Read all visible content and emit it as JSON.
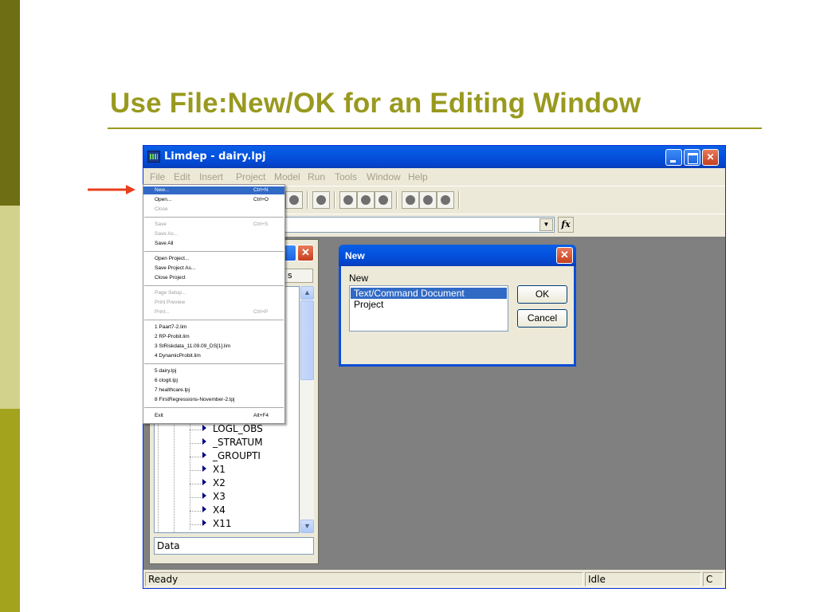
{
  "slide": {
    "title": "Use File:New/OK for an Editing Window",
    "colors": {
      "accent": "#99991f",
      "bar_dark": "#6e6e14",
      "bar_light": "#d2d28c",
      "bar_mid": "#a3a31e",
      "arrow": "#e8401c"
    }
  },
  "app": {
    "title": "Limdep - dairy.lpj",
    "menubar": [
      "File",
      "Edit",
      "Insert",
      "Project",
      "Model",
      "Run",
      "Tools",
      "Window",
      "Help"
    ],
    "fx_label": "fx",
    "status_left": "Ready",
    "status_mid": "Idle",
    "status_right": "C"
  },
  "file_menu": {
    "items": [
      {
        "label": "New...",
        "shortcut": "Ctrl+N",
        "state": "highlighted"
      },
      {
        "label": "Open...",
        "shortcut": "Ctrl+O",
        "state": "enabled"
      },
      {
        "label": "Close",
        "shortcut": "",
        "state": "disabled"
      },
      {
        "label": "Save",
        "shortcut": "Ctrl+S",
        "state": "disabled"
      },
      {
        "label": "Save As...",
        "shortcut": "",
        "state": "disabled"
      },
      {
        "label": "Save All",
        "shortcut": "",
        "state": "enabled"
      },
      {
        "label": "Open Project...",
        "shortcut": "",
        "state": "enabled"
      },
      {
        "label": "Save Project As...",
        "shortcut": "",
        "state": "enabled"
      },
      {
        "label": "Close Project",
        "shortcut": "",
        "state": "enabled"
      },
      {
        "label": "Page Setup...",
        "shortcut": "",
        "state": "disabled"
      },
      {
        "label": "Print Preview",
        "shortcut": "",
        "state": "disabled"
      },
      {
        "label": "Print...",
        "shortcut": "Ctrl+P",
        "state": "disabled"
      },
      {
        "label": "1 Paart7-2.lim",
        "shortcut": "",
        "state": "enabled"
      },
      {
        "label": "2 RP-Probit.lim",
        "shortcut": "",
        "state": "enabled"
      },
      {
        "label": "3 StRiskdata_11.09.09_DS[1].lim",
        "shortcut": "",
        "state": "enabled"
      },
      {
        "label": "4 DynamicProbit.lim",
        "shortcut": "",
        "state": "enabled"
      },
      {
        "label": "5 dairy.lpj",
        "shortcut": "",
        "state": "enabled"
      },
      {
        "label": "6 clogit.lpj",
        "shortcut": "",
        "state": "enabled"
      },
      {
        "label": "7 healthcare.lpj",
        "shortcut": "",
        "state": "enabled"
      },
      {
        "label": "8 FirstRegressions-November-2.lpj",
        "shortcut": "",
        "state": "enabled"
      },
      {
        "label": "Exit",
        "shortcut": "Alt+F4",
        "state": "enabled"
      }
    ]
  },
  "project_window": {
    "tab_label": "s",
    "variables": [
      "LOGL_OBS",
      "_STRATUM",
      "_GROUPTI",
      "X1",
      "X2",
      "X3",
      "X4",
      "X11"
    ],
    "status": "Data"
  },
  "new_dialog": {
    "title": "New",
    "label": "New",
    "options": [
      "Text/Command Document",
      "Project"
    ],
    "selected_index": 0,
    "ok_label": "OK",
    "cancel_label": "Cancel"
  }
}
